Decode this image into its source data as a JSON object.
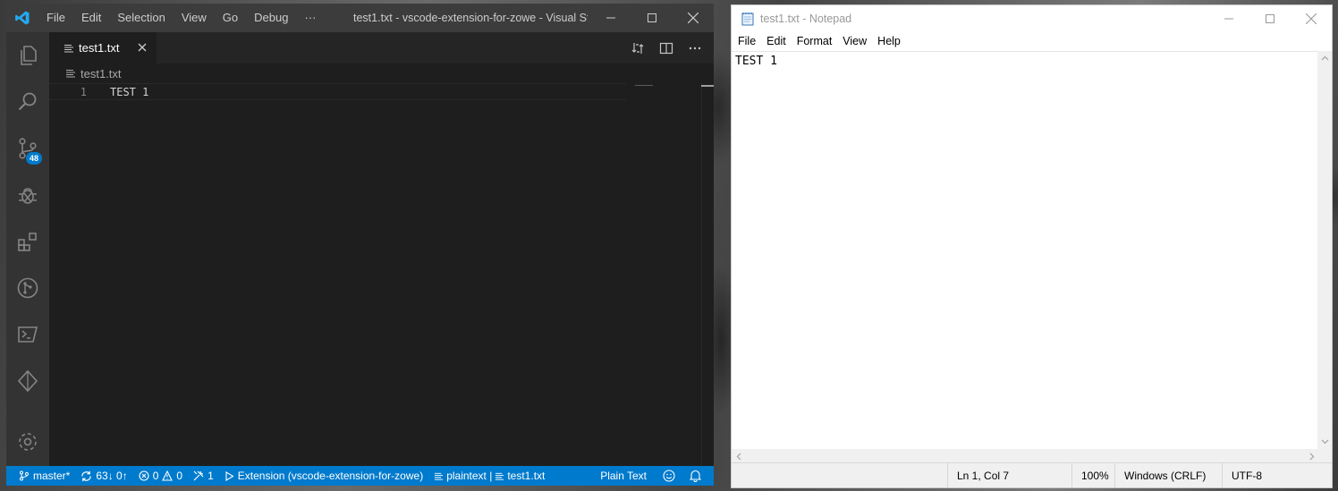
{
  "vscode": {
    "menu": [
      "File",
      "Edit",
      "Selection",
      "View",
      "Go",
      "Debug",
      "···"
    ],
    "window_title": "test1.txt - vscode-extension-for-zowe - Visual St...",
    "scm_badge": "48",
    "tab": {
      "label": "test1.txt"
    },
    "breadcrumb": "test1.txt",
    "editor": {
      "line_number": "1",
      "line_text": "TEST 1"
    },
    "status": {
      "branch": "master*",
      "sync": "63↓ 0↑",
      "errors": "0",
      "warnings": "0",
      "tools": "1",
      "launch": "Extension (vscode-extension-for-zowe)",
      "outline": "plaintext | ",
      "file": "test1.txt",
      "language": "Plain Text"
    },
    "accent_color": "#007acc"
  },
  "notepad": {
    "window_title": "test1.txt - Notepad",
    "menu": [
      "File",
      "Edit",
      "Format",
      "View",
      "Help"
    ],
    "content": "TEST 1",
    "status": {
      "position": "Ln 1, Col 7",
      "zoom": "100%",
      "line_ending": "Windows (CRLF)",
      "encoding": "UTF-8"
    }
  }
}
